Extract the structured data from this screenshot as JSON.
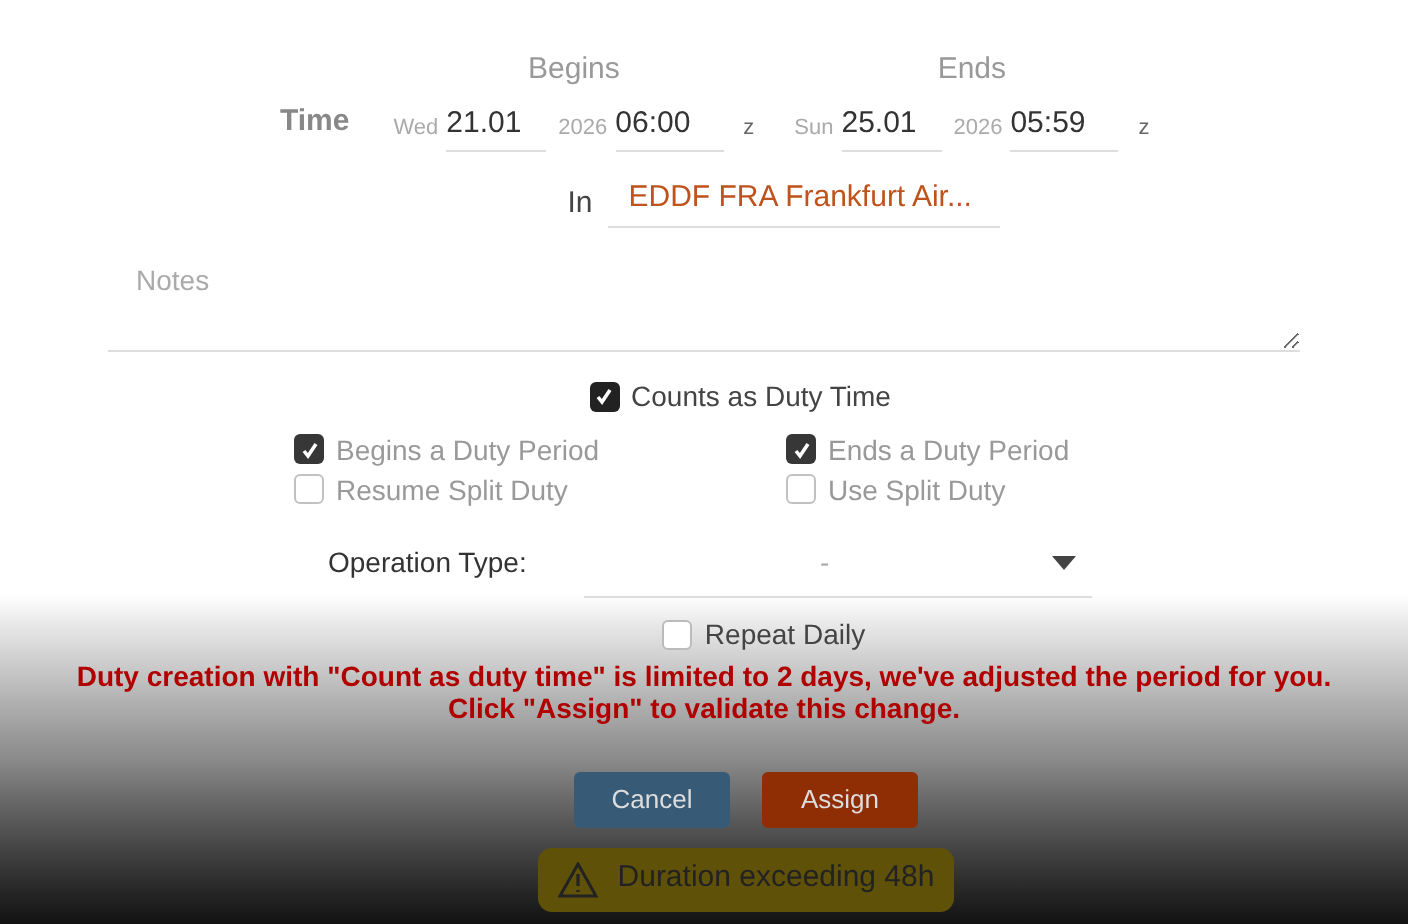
{
  "time": {
    "label": "Time",
    "begins": {
      "heading": "Begins",
      "weekday": "Wed",
      "date": "21.01",
      "year": "2026",
      "time": "06:00",
      "zone": "z"
    },
    "ends": {
      "heading": "Ends",
      "weekday": "Sun",
      "date": "25.01",
      "year": "2026",
      "time": "05:59",
      "zone": "z"
    }
  },
  "location": {
    "label": "In",
    "value": "EDDF FRA Frankfurt Air..."
  },
  "notes": {
    "placeholder": "Notes"
  },
  "counts_as_duty": {
    "label": "Counts as Duty Time",
    "checked": true,
    "disabled": false
  },
  "duty_options": [
    {
      "label": "Begins a Duty Period",
      "checked": true,
      "disabled": true
    },
    {
      "label": "Ends a Duty Period",
      "checked": true,
      "disabled": true
    },
    {
      "label": "Resume Split Duty",
      "checked": false,
      "disabled": true
    },
    {
      "label": "Use Split Duty",
      "checked": false,
      "disabled": true
    }
  ],
  "operation_type": {
    "label": "Operation Type:",
    "value": "-"
  },
  "repeat_daily": {
    "label": "Repeat Daily",
    "checked": false,
    "disabled": false
  },
  "error_message": "Duty creation with \"Count as duty time\" is limited to 2 days, we've adjusted the period for you. Click \"Assign\" to validate this change.",
  "buttons": [
    {
      "label": "Cancel",
      "kind": "cancel"
    },
    {
      "label": "Assign",
      "kind": "primary"
    }
  ],
  "warning": {
    "text": "Duration exceeding 48h"
  }
}
